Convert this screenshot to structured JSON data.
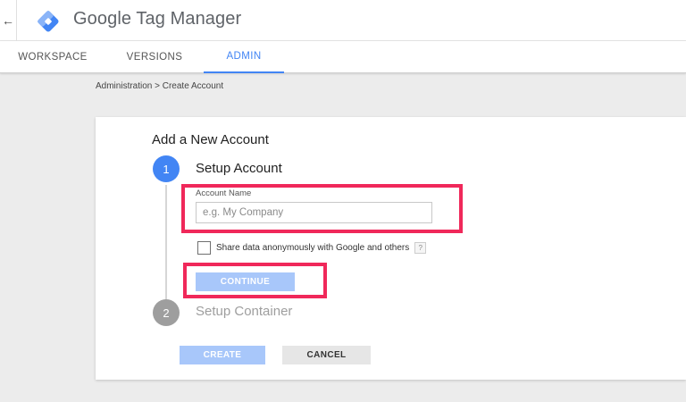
{
  "header": {
    "back_icon": "←",
    "brand": "Google",
    "product": "Tag Manager"
  },
  "tabs": [
    {
      "label": "WORKSPACE",
      "active": false
    },
    {
      "label": "VERSIONS",
      "active": false
    },
    {
      "label": "ADMIN",
      "active": true
    }
  ],
  "breadcrumb": "Administration > Create Account",
  "card": {
    "title": "Add a New Account",
    "steps": [
      {
        "number": "1",
        "label": "Setup Account",
        "state": "active"
      },
      {
        "number": "2",
        "label": "Setup Container",
        "state": "inactive"
      }
    ],
    "account_name": {
      "label": "Account Name",
      "value": "",
      "placeholder": "e.g. My Company"
    },
    "share_checkbox": {
      "label": "Share data anonymously with Google and others",
      "checked": false,
      "help": "?"
    },
    "continue_label": "CONTINUE",
    "create_label": "CREATE",
    "cancel_label": "CANCEL"
  },
  "colors": {
    "accent": "#4285f4",
    "disabled_button": "#a8c7fa",
    "highlight": "#f0285a",
    "inactive_step": "#9e9e9e"
  }
}
